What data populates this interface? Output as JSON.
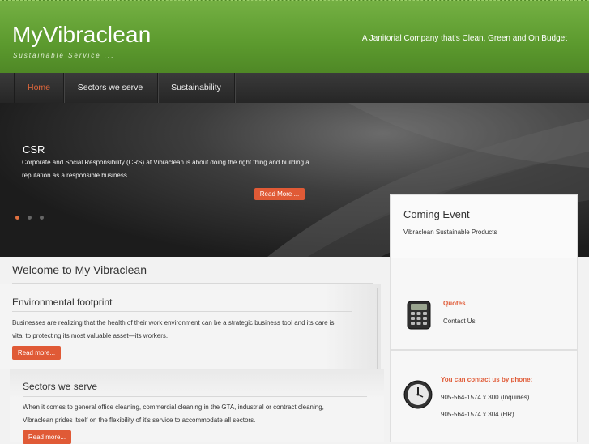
{
  "header": {
    "brand": "MyVibraclean",
    "tagline": "Sustainable Service ...",
    "slogan": "A Janitorial Company that's Clean, Green and On Budget"
  },
  "nav": {
    "items": [
      {
        "label": "Home",
        "active": true
      },
      {
        "label": "Sectors we serve",
        "active": false
      },
      {
        "label": "Sustainability",
        "active": false
      }
    ]
  },
  "hero": {
    "title": "CSR",
    "text": "Corporate and Social Responsibility (CRS) at Vibraclean is about doing the right thing and building a reputation as a responsible business.",
    "button": "Read More ...",
    "slides_total": 3,
    "slide_active": 1
  },
  "event": {
    "title": "Coming Event",
    "text": "Vibraclean Sustainable Products"
  },
  "main": {
    "welcome": "Welcome to My Vibraclean",
    "section1": {
      "title": "Environmental footprint",
      "text": "Businesses are realizing that the health of their work environment can be a strategic business tool and its care is vital to protecting its most valuable asset—its workers.",
      "button": "Read more..."
    },
    "section2": {
      "title": "Sectors we serve",
      "text": "When it comes to general office cleaning, commercial cleaning in the GTA, industrial or contract cleaning, Vibraclean prides itself on the flexibility of it's service to accommodate all sectors.",
      "button": "Read more..."
    }
  },
  "sidebar": {
    "quotes": {
      "heading": "Quotes",
      "link": "Contact Us",
      "icon": "calculator-icon"
    },
    "phone": {
      "heading": "You can contact us by phone:",
      "lines": [
        "905-564-1574 x 300 (Inquiries)",
        "905-564-1574 x 304 (HR)"
      ],
      "icon": "clock-icon"
    }
  },
  "colors": {
    "brand_green": "#5c9a2e",
    "accent_orange": "#e05a36",
    "nav_bg": "#2e2e2e"
  }
}
